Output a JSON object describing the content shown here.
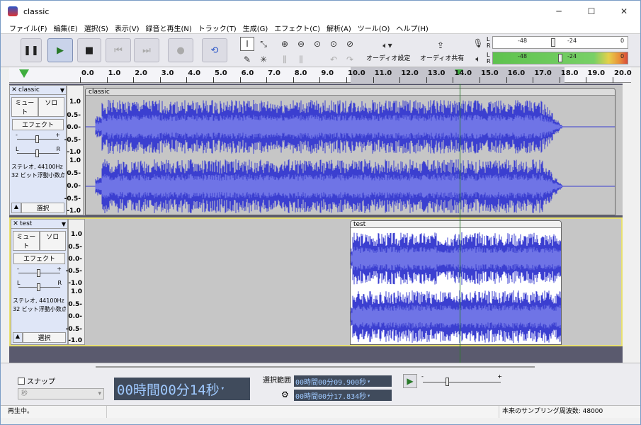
{
  "window": {
    "title": "classic",
    "minimize": "─",
    "maximize": "☐",
    "close": "✕"
  },
  "menu": [
    "ファイル(F)",
    "編集(E)",
    "選択(S)",
    "表示(V)",
    "録音と再生(N)",
    "トラック(T)",
    "生成(G)",
    "エフェクト(C)",
    "解析(A)",
    "ツール(O)",
    "ヘルプ(H)"
  ],
  "toolbar": {
    "pause": "❚❚",
    "play": "▶",
    "stop": "■",
    "skip_start": "⏮",
    "skip_end": "⏭",
    "record": "●",
    "loop": "⟲",
    "audio_setup_label": "オーディオ設定",
    "share_label": "オーディオ共有",
    "rec_meter_scale": [
      "-48",
      "-24",
      "0"
    ],
    "play_meter_scale": [
      "-48",
      "-24",
      "0"
    ],
    "meter_L": "L",
    "meter_R": "R"
  },
  "ruler": {
    "ticks": [
      "0.0",
      "1.0",
      "2.0",
      "3.0",
      "4.0",
      "5.0",
      "6.0",
      "7.0",
      "8.0",
      "9.0",
      "10.0",
      "11.0",
      "12.0",
      "13.0",
      "14.0",
      "15.0",
      "16.0",
      "17.0",
      "18.0",
      "19.0",
      "20.0"
    ]
  },
  "tracks": [
    {
      "name": "classic",
      "clip_name": "classic",
      "mute": "ミュート",
      "solo": "ソロ",
      "effect": "エフェクト",
      "info1": "ステレオ, 44100Hz",
      "info2": "32 ビット浮動小数点",
      "select": "選択",
      "scale": [
        "1.0",
        "0.5-",
        "0.0-",
        "-0.5-",
        "-1.0",
        "1.0",
        "0.5-",
        "0.0-",
        "-0.5-",
        "-1.0"
      ]
    },
    {
      "name": "test",
      "clip_name": "test",
      "mute": "ミュート",
      "solo": "ソロ",
      "effect": "エフェクト",
      "info1": "ステレオ, 44100Hz",
      "info2": "32 ビット浮動小数点",
      "select": "選択",
      "scale": [
        "1.0",
        "0.5-",
        "0.0-",
        "-0.5-",
        "-1.0",
        "1.0",
        "0.5-",
        "0.0-",
        "-0.5-",
        "-1.0"
      ]
    }
  ],
  "bottom": {
    "snap_label": "スナップ",
    "snap_unit": "秒",
    "time_display": "00時間00分14秒",
    "selection_label": "選択範囲",
    "sel_start": "00時間00分09.900秒",
    "sel_end": "00時間00分17.834秒"
  },
  "status": {
    "left": "再生中。",
    "right": "本来のサンプリング周波数: 48000"
  },
  "colors": {
    "wave": "#3b3fd0",
    "wave_light": "#6f74e6",
    "selected_bg": "#ffffff",
    "track_bg": "#c6c6c6",
    "time_bg": "#404b5c",
    "time_fg": "#9fc9ff"
  }
}
